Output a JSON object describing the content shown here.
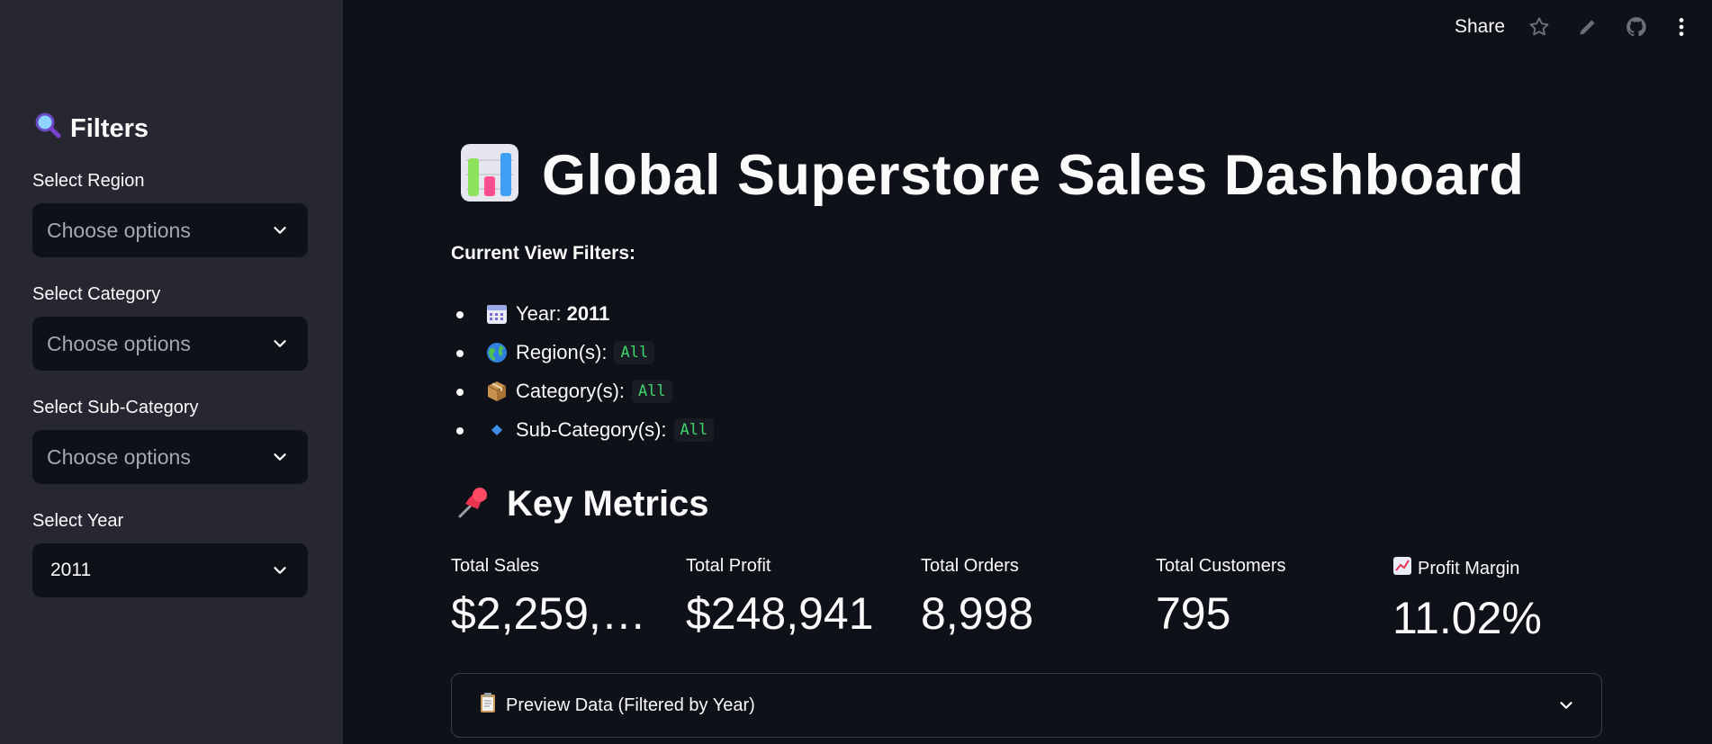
{
  "sidebar": {
    "heading": "Filters",
    "heading_icon": "magnifier-icon",
    "filters": [
      {
        "label": "Select Region",
        "placeholder": "Choose options"
      },
      {
        "label": "Select Category",
        "placeholder": "Choose options"
      },
      {
        "label": "Select Sub-Category",
        "placeholder": "Choose options"
      },
      {
        "label": "Select Year",
        "value": "2011"
      }
    ]
  },
  "toolbar": {
    "share_label": "Share",
    "icons": [
      "star-icon",
      "pencil-icon",
      "github-icon",
      "more-vertical-icon"
    ]
  },
  "main": {
    "title": "Global Superstore Sales Dashboard",
    "current_view": {
      "heading": "Current View Filters:",
      "items": [
        {
          "icon": "calendar-icon",
          "label": "Year:",
          "value": "2011"
        },
        {
          "icon": "globe-icon",
          "label": "Region(s):",
          "value": "All"
        },
        {
          "icon": "package-icon",
          "label": "Category(s):",
          "value": "All"
        },
        {
          "icon": "diamond-icon",
          "label": "Sub-Category(s):",
          "value": "All"
        }
      ]
    },
    "key_metrics": {
      "heading": "Key Metrics",
      "metrics": [
        {
          "label": "Total Sales",
          "value": "$2,259,…"
        },
        {
          "label": "Total Profit",
          "value": "$248,941"
        },
        {
          "label": "Total Orders",
          "value": "8,998"
        },
        {
          "label": "Total Customers",
          "value": "795"
        },
        {
          "label": "Profit Margin",
          "value": "11.02%"
        }
      ]
    },
    "expander": {
      "label": "Preview Data (Filtered by Year)"
    }
  },
  "colors": {
    "background": "#0e1117",
    "sidebar": "#262730",
    "input": "#0e1117",
    "code_text": "#3dd56d"
  }
}
